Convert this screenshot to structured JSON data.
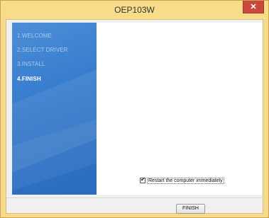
{
  "window": {
    "title": "OEP103W",
    "close_glyph": "✕",
    "accent_color": "#f7dc8a"
  },
  "sidebar": {
    "steps": [
      {
        "label": "1.WELCOME",
        "active": false
      },
      {
        "label": "2.SELECT DRIVER",
        "active": false
      },
      {
        "label": "3.INSTALL",
        "active": false
      },
      {
        "label": "4.FINISH",
        "active": true
      }
    ],
    "background_color": "#3a7fcf"
  },
  "content": {
    "restart_checkbox": {
      "label": "Restart the computer immediately",
      "checked": true,
      "check_glyph": "✔"
    }
  },
  "footer": {
    "finish_label": "FINISH"
  },
  "icons": {
    "close": "close-icon",
    "check": "checkmark-icon"
  }
}
